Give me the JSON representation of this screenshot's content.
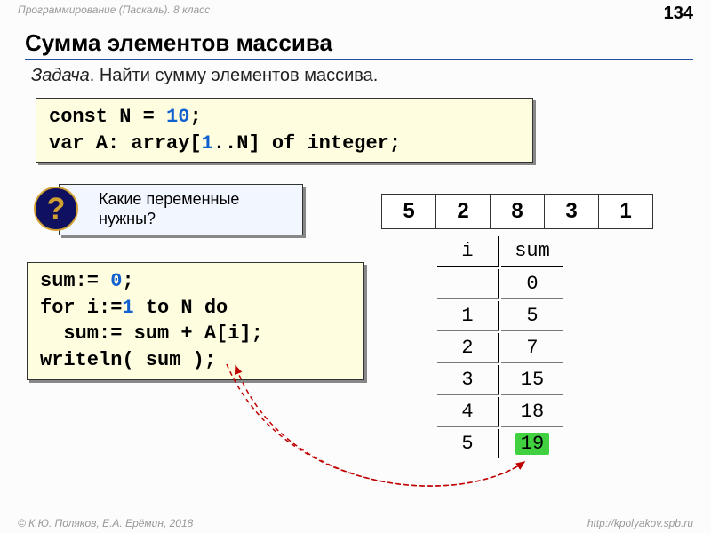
{
  "header": {
    "course": "Программирование (Паскаль). 8 класс",
    "page": "134"
  },
  "title": "Сумма элементов массива",
  "task_prefix": "Задача",
  "task_text": ". Найти сумму элементов массива.",
  "code1": {
    "l1a": "const N = ",
    "l1b": "10",
    "l1c": ";",
    "l2a": "var A: array[",
    "l2b": "1",
    "l2c": "..N] of integer;"
  },
  "question": "Какие переменные нужны?",
  "q_mark": "?",
  "array": [
    "5",
    "2",
    "8",
    "3",
    "1"
  ],
  "code2": {
    "l1a": "sum:= ",
    "l1b": "0",
    "l1c": ";",
    "l2a": "for i:=",
    "l2b": "1",
    "l2c": " to N do",
    "l3": "  sum:= sum + A[i];",
    "l4": "writeln( sum );"
  },
  "trace": {
    "head_i": "i",
    "head_sum": "sum",
    "rows": [
      {
        "i": "",
        "sum": "0"
      },
      {
        "i": "1",
        "sum": "5"
      },
      {
        "i": "2",
        "sum": "7"
      },
      {
        "i": "3",
        "sum": "15"
      },
      {
        "i": "4",
        "sum": "18"
      },
      {
        "i": "5",
        "sum": "19"
      }
    ]
  },
  "footer": {
    "left": "© К.Ю. Поляков, Е.А. Ерёмин, 2018",
    "right": "http://kpolyakov.spb.ru"
  }
}
